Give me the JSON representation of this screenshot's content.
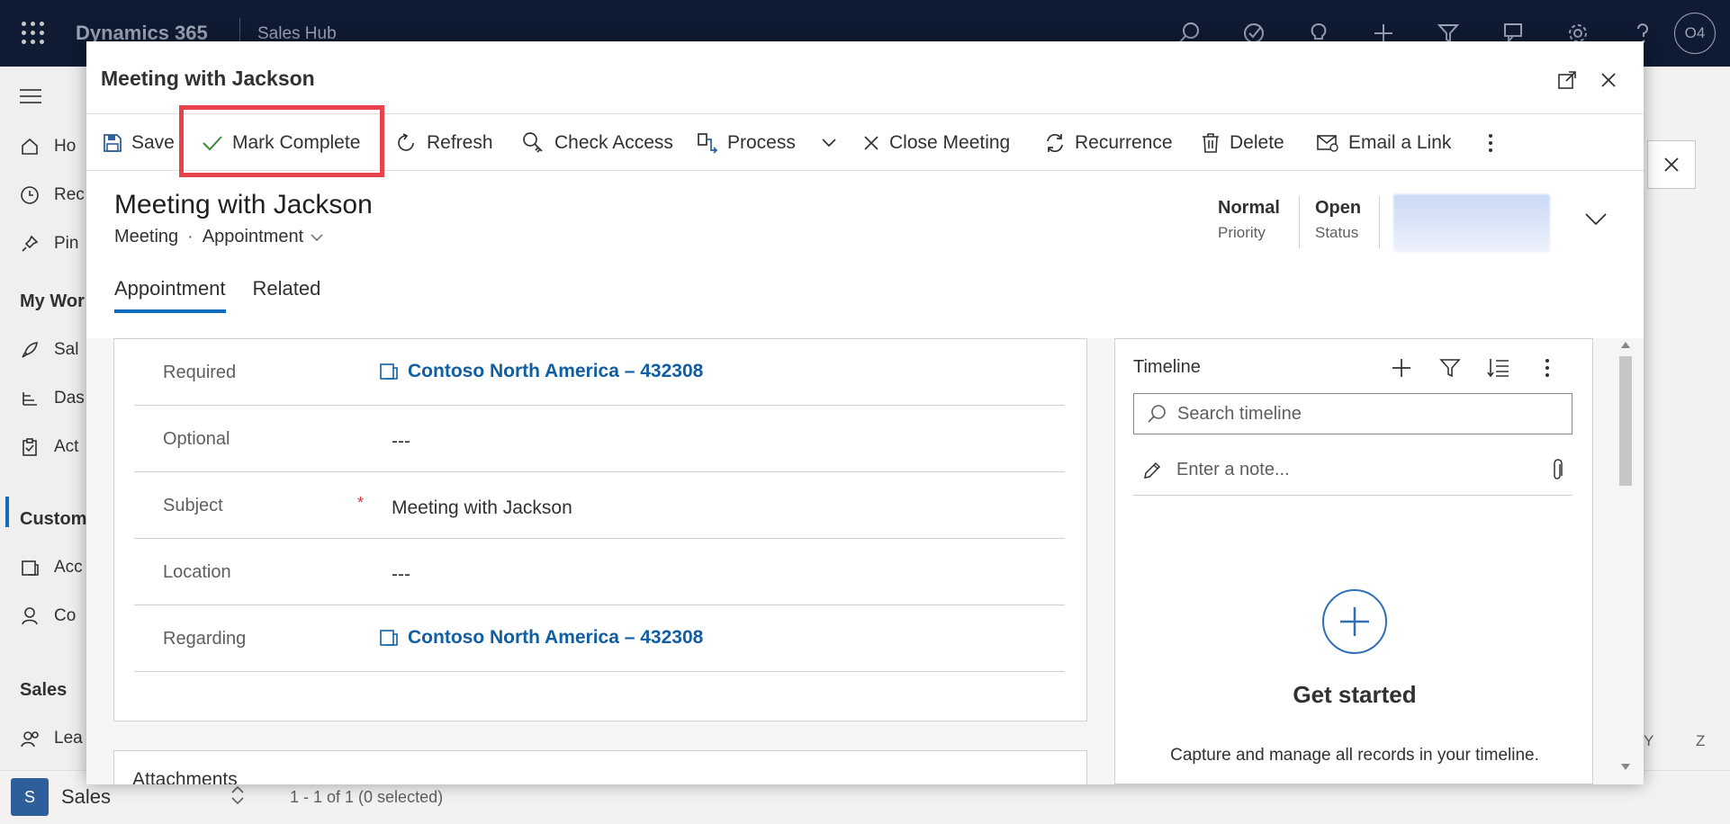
{
  "topbar": {
    "brand": "Dynamics 365",
    "app_name": "Sales Hub",
    "avatar_initials": "O4",
    "icons": [
      "search-icon",
      "target-icon",
      "lightbulb-icon",
      "plus-icon",
      "filter-icon",
      "chat-icon",
      "gear-icon",
      "help-icon"
    ]
  },
  "leftnav": {
    "items": [
      {
        "label": "Ho",
        "icon": "home-icon"
      },
      {
        "label": "Rec",
        "icon": "clock-icon"
      },
      {
        "label": "Pin",
        "icon": "pin-icon"
      }
    ],
    "section_work": "My Wor",
    "work_items": [
      {
        "label": "Sal",
        "icon": "rocket-icon"
      },
      {
        "label": "Das",
        "icon": "dashboard-icon"
      },
      {
        "label": "Act",
        "icon": "clipboard-icon"
      }
    ],
    "section_customers": "Custom",
    "customer_items": [
      {
        "label": "Acc",
        "icon": "account-icon"
      },
      {
        "label": "Co",
        "icon": "person-icon"
      }
    ],
    "section_sales": "Sales",
    "sales_items": [
      {
        "label": "Lea",
        "icon": "lead-icon"
      }
    ]
  },
  "area": {
    "badge": "S",
    "label": "Sales"
  },
  "status_bar": "1 - 1 of 1 (0 selected)",
  "alpha_index": [
    "Y",
    "Z"
  ],
  "dialog": {
    "title": "Meeting with Jackson"
  },
  "commands": {
    "save": "Save",
    "mark_complete": "Mark Complete",
    "refresh": "Refresh",
    "check_access": "Check Access",
    "process": "Process",
    "close_meeting": "Close Meeting",
    "recurrence": "Recurrence",
    "delete": "Delete",
    "email_link": "Email a Link"
  },
  "record": {
    "title": "Meeting with Jackson",
    "entity": "Meeting",
    "form": "Appointment",
    "priority_value": "Normal",
    "priority_label": "Priority",
    "status_value": "Open",
    "status_label": "Status"
  },
  "tabs": [
    {
      "label": "Appointment",
      "active": true
    },
    {
      "label": "Related",
      "active": false
    }
  ],
  "form": {
    "required_label": "Required",
    "required_value": "Contoso North America – 432308",
    "optional_label": "Optional",
    "optional_value": "---",
    "subject_label": "Subject",
    "subject_req_marker": "*",
    "subject_value": "Meeting with Jackson",
    "location_label": "Location",
    "location_value": "---",
    "regarding_label": "Regarding",
    "regarding_value": "Contoso North America – 432308"
  },
  "attachments_label": "Attachments",
  "timeline": {
    "title": "Timeline",
    "search_placeholder": "Search timeline",
    "note_placeholder": "Enter a note...",
    "empty_title": "Get started",
    "empty_desc": "Capture and manage all records in your timeline."
  },
  "colors": {
    "highlight": "#e8424b",
    "accent": "#0f6cbd",
    "link": "#115ea3",
    "topbar": "#0f1b33"
  }
}
